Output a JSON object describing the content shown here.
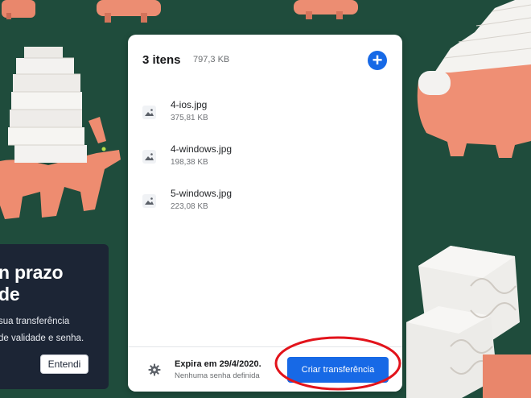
{
  "panel": {
    "count": "3 itens",
    "total_size": "797,3 KB",
    "add_label": "+"
  },
  "files": [
    {
      "name": "4-ios.jpg",
      "size": "375,81 KB"
    },
    {
      "name": "4-windows.jpg",
      "size": "198,38 KB"
    },
    {
      "name": "5-windows.jpg",
      "size": "223,08 KB"
    }
  ],
  "footer": {
    "expiry": "Expira em 29/4/2020.",
    "password": "Nenhuma senha definida",
    "create_label": "Criar transferência"
  },
  "tooltip": {
    "title_line1": "n prazo",
    "title_line2": "de",
    "body_line1": "sua transferência",
    "body_line2": "de validade e senha.",
    "button": "Entendi"
  },
  "colors": {
    "background": "#1f4c3c",
    "accent": "#1769e6",
    "highlight_ring": "#e2131b",
    "tooltip_bg": "#1c2535"
  },
  "icons": [
    "image-file-icon",
    "plus-icon",
    "gear-icon"
  ]
}
